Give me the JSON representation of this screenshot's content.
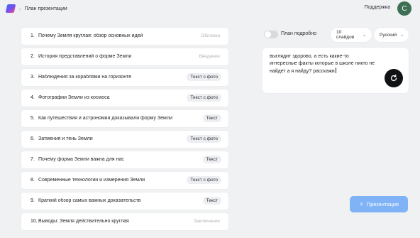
{
  "header": {
    "breadcrumb_separator": "›",
    "breadcrumb": "План презентации",
    "support": "Поддержка",
    "avatar_letter": "С"
  },
  "outline": [
    {
      "num": "1.",
      "title": "Почему Земля круглая: обзор основных идей",
      "tag": "Обложка",
      "tag_style": "plain"
    },
    {
      "num": "2.",
      "title": "История представлений о форме Земли",
      "tag": "Введение",
      "tag_style": "plain"
    },
    {
      "num": "3.",
      "title": "Наблюдения за кораблями на горизонте",
      "tag": "Текст с фото",
      "tag_style": "pill"
    },
    {
      "num": "4.",
      "title": "Фотографии Земли из космоса",
      "tag": "Текст с фото",
      "tag_style": "pill"
    },
    {
      "num": "5.",
      "title": "Как путешествия и астрономия доказывали форму Земли",
      "tag": "Текст",
      "tag_style": "pill"
    },
    {
      "num": "6.",
      "title": "Затмения и тень Земли",
      "tag": "Текст с фото",
      "tag_style": "pill"
    },
    {
      "num": "7.",
      "title": "Почему форма Земли важна для нас",
      "tag": "Текст",
      "tag_style": "pill"
    },
    {
      "num": "8.",
      "title": "Современные технологии и измерения Земли",
      "tag": "Текст с фото",
      "tag_style": "pill"
    },
    {
      "num": "9.",
      "title": "Краткий обзор самых важных доказательств",
      "tag": "Текст",
      "tag_style": "pill"
    },
    {
      "num": "10.",
      "title": "Выводы: Земля действительно круглая",
      "tag": "Заключение",
      "tag_style": "plain"
    }
  ],
  "controls": {
    "detailed_plan_label": "План подробно",
    "detailed_plan_on": false,
    "slides": "10 слайдов",
    "language": "Русский",
    "chevron": "⌄"
  },
  "prompt": {
    "text": "выглядит здорово, а есть какие-то интересные факты которые в школе никто не найдет а я найду? расскажи"
  },
  "actions": {
    "create_icon": "✧",
    "create_label": "Презентация"
  },
  "colors": {
    "accent_button": "#7fb3f5",
    "avatar": "#3f6f55"
  }
}
